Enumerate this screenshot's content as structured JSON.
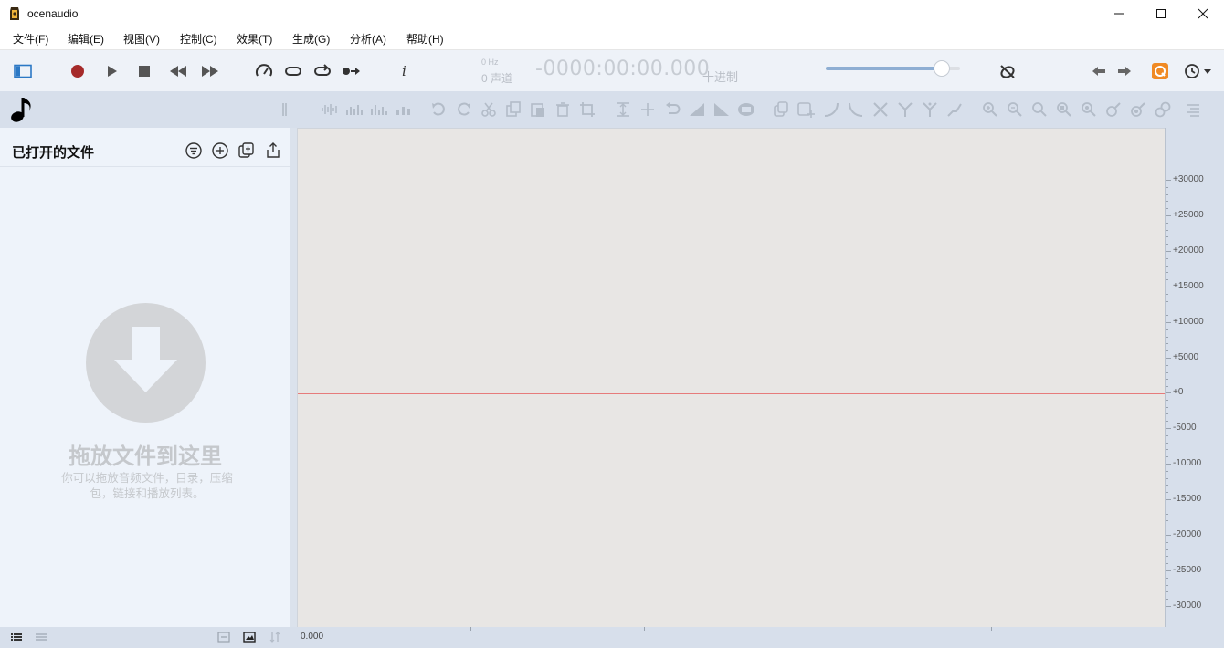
{
  "app": {
    "title": "ocenaudio"
  },
  "menu": [
    "文件(F)",
    "编辑(E)",
    "视图(V)",
    "控制(C)",
    "效果(T)",
    "生成(G)",
    "分析(A)",
    "帮助(H)"
  ],
  "display": {
    "sample_rate": "0 Hz",
    "channels": "0 声道",
    "time": "-0000:00:00.000",
    "time_format": "十进制"
  },
  "volume": {
    "level": 0.87
  },
  "sidebar": {
    "title": "已打开的文件",
    "drop_title": "拖放文件到这里",
    "drop_desc": "你可以拖放音频文件，目录，压缩包，链接和播放列表。"
  },
  "ruler": {
    "labels": [
      "+30000",
      "+25000",
      "+20000",
      "+15000",
      "+10000",
      "+5000",
      "+0",
      "-5000",
      "-10000",
      "-15000",
      "-20000",
      "-25000",
      "-30000"
    ]
  },
  "status": {
    "position": "0.000"
  },
  "colors": {
    "record": "#a52a2a",
    "accent": "#2b78c5",
    "zero_line": "#e67b7b",
    "waveform_bg": "#e8e6e4",
    "update_badge": "#f08a24"
  }
}
